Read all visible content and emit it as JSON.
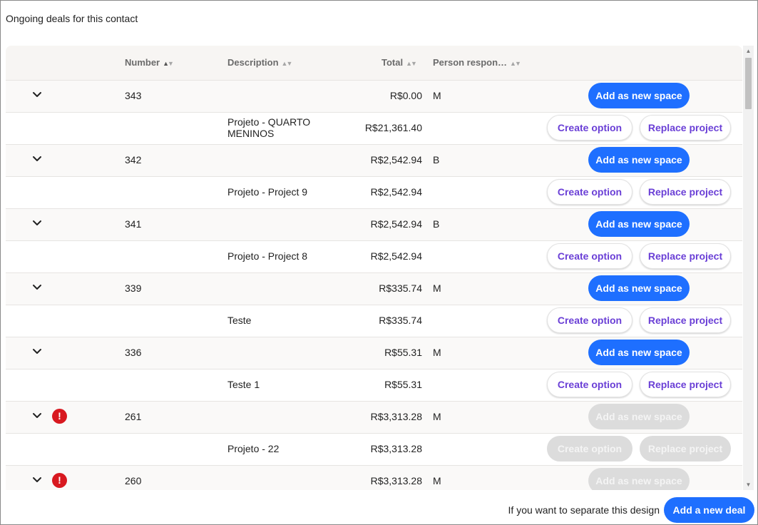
{
  "heading": "Ongoing deals for this contact",
  "columns": {
    "number": "Number",
    "description": "Description",
    "total": "Total",
    "person": "Person respon…"
  },
  "sort_glyphs": {
    "asc": "▲",
    "desc": "▼"
  },
  "deals": [
    {
      "number": "343",
      "total": "R$0.00",
      "person": "M",
      "warning": false,
      "enabled": true,
      "project": {
        "description": "Projeto - QUARTO MENINOS",
        "total": "R$21,361.40"
      }
    },
    {
      "number": "342",
      "total": "R$2,542.94",
      "person": "B",
      "warning": false,
      "enabled": true,
      "project": {
        "description": "Projeto - Project 9",
        "total": "R$2,542.94"
      }
    },
    {
      "number": "341",
      "total": "R$2,542.94",
      "person": "B",
      "warning": false,
      "enabled": true,
      "project": {
        "description": "Projeto - Project 8",
        "total": "R$2,542.94"
      }
    },
    {
      "number": "339",
      "total": "R$335.74",
      "person": "M",
      "warning": false,
      "enabled": true,
      "project": {
        "description": "Teste",
        "total": "R$335.74"
      }
    },
    {
      "number": "336",
      "total": "R$55.31",
      "person": "M",
      "warning": false,
      "enabled": true,
      "project": {
        "description": "Teste 1",
        "total": "R$55.31"
      }
    },
    {
      "number": "261",
      "total": "R$3,313.28",
      "person": "M",
      "warning": true,
      "enabled": false,
      "project": {
        "description": "Projeto - 22",
        "total": "R$3,313.28"
      }
    },
    {
      "number": "260",
      "total": "R$3,313.28",
      "person": "M",
      "warning": true,
      "enabled": false,
      "project": null
    }
  ],
  "buttons": {
    "add_space": "Add as new space",
    "create_option": "Create option",
    "replace_project": "Replace project",
    "add_deal": "Add a new deal"
  },
  "warning_glyph": "!",
  "footer_text": "If you want to separate this design",
  "icons": {
    "expand": "chevron-down-icon",
    "warning": "warning-icon",
    "scroll_up": "arrow-up-icon",
    "scroll_down": "arrow-down-icon"
  },
  "scroll_glyphs": {
    "up": "▲",
    "down": "▼"
  },
  "colors": {
    "primary": "#1e6fff",
    "secondary_text": "#6a3fd6",
    "warning": "#d81920",
    "disabled": "#dcdcdc"
  }
}
